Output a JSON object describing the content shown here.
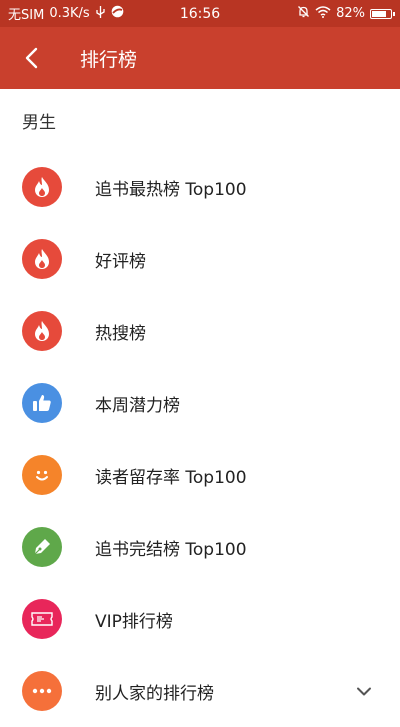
{
  "status_bar": {
    "carrier": "无SIM",
    "speed": "0.3K/s",
    "time": "16:56",
    "battery_percent": "82%",
    "battery_level": 0.82
  },
  "toolbar": {
    "title": "排行榜"
  },
  "section": {
    "title": "男生"
  },
  "items": [
    {
      "label": "追书最热榜 Top100",
      "icon": "flame-icon",
      "color": "#e64a3b"
    },
    {
      "label": "好评榜",
      "icon": "flame-icon",
      "color": "#e64a3b"
    },
    {
      "label": "热搜榜",
      "icon": "flame-icon",
      "color": "#e64a3b"
    },
    {
      "label": "本周潜力榜",
      "icon": "thumbs-up-icon",
      "color": "#4a90e2"
    },
    {
      "label": "读者留存率 Top100",
      "icon": "smile-icon",
      "color": "#f5842a"
    },
    {
      "label": "追书完结榜 Top100",
      "icon": "pen-icon",
      "color": "#5fa84a"
    },
    {
      "label": "VIP排行榜",
      "icon": "ticket-icon",
      "color": "#e8265a"
    },
    {
      "label": "别人家的排行榜",
      "icon": "more-icon",
      "color": "#f5703a"
    }
  ],
  "colors": {
    "status_bar": "#b83523",
    "toolbar": "#c9402d"
  }
}
